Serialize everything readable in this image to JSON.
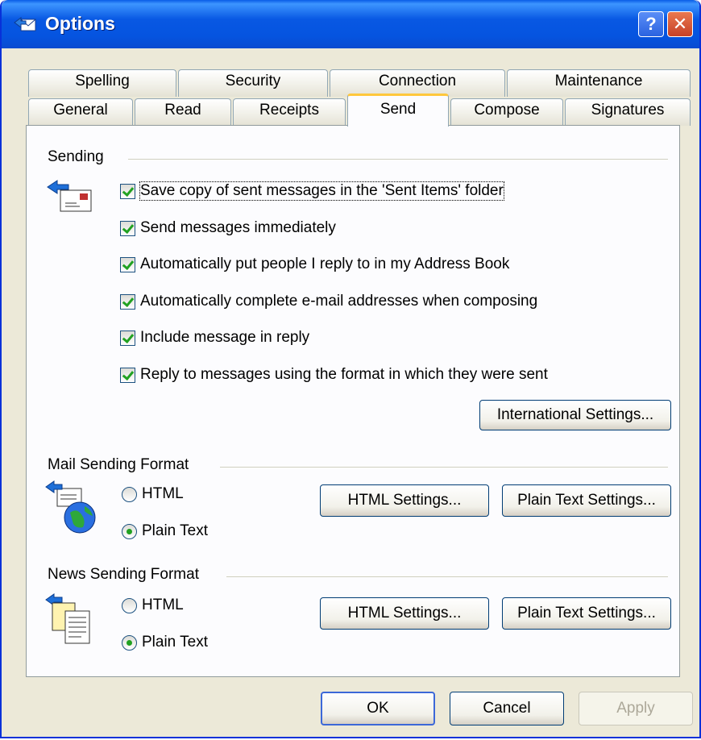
{
  "window": {
    "title": "Options",
    "help_glyph": "?",
    "close_glyph": "✕"
  },
  "tabs": {
    "row1": [
      "Spelling",
      "Security",
      "Connection",
      "Maintenance"
    ],
    "row2": [
      "General",
      "Read",
      "Receipts",
      "Send",
      "Compose",
      "Signatures"
    ],
    "active": "Send"
  },
  "sending": {
    "heading": "Sending",
    "options": [
      {
        "label": "Save copy of sent messages in the 'Sent Items' folder",
        "checked": true
      },
      {
        "label": "Send messages immediately",
        "checked": true
      },
      {
        "label": "Automatically put people I reply to in my Address Book",
        "checked": true
      },
      {
        "label": "Automatically complete e-mail addresses when composing",
        "checked": true
      },
      {
        "label": "Include message in reply",
        "checked": true
      },
      {
        "label": "Reply to messages using the format in which they were sent",
        "checked": true
      }
    ],
    "international_button": "International Settings..."
  },
  "mail_format": {
    "heading": "Mail Sending Format",
    "html_label": "HTML",
    "plain_label": "Plain Text",
    "selected": "Plain Text",
    "html_settings_button": "HTML Settings...",
    "plain_settings_button": "Plain Text Settings..."
  },
  "news_format": {
    "heading": "News Sending Format",
    "html_label": "HTML",
    "plain_label": "Plain Text",
    "selected": "Plain Text",
    "html_settings_button": "HTML Settings...",
    "plain_settings_button": "Plain Text Settings..."
  },
  "footer": {
    "ok": "OK",
    "cancel": "Cancel",
    "apply": "Apply"
  },
  "colors": {
    "titlebar": "#0858e3",
    "face": "#ece9d8",
    "check": "#21a121",
    "active_tab_accent": "#ffc73c"
  }
}
